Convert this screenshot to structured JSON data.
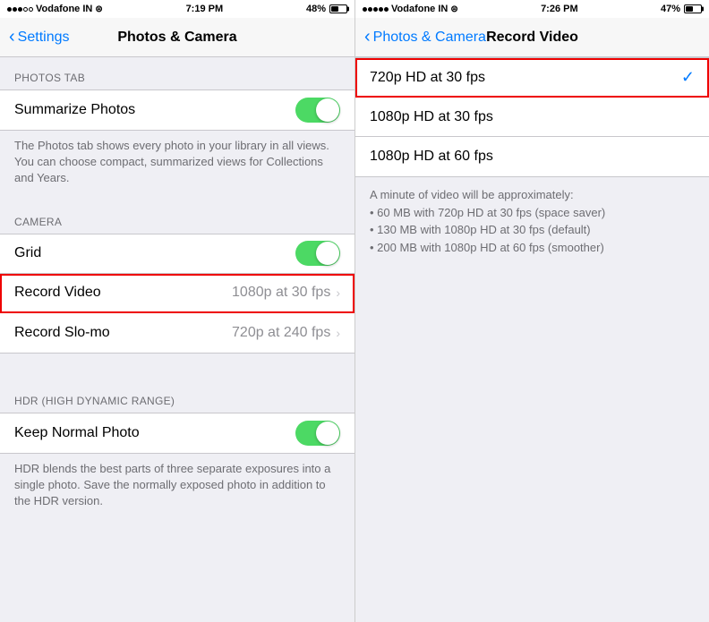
{
  "left_panel": {
    "status": {
      "carrier": "Vodafone IN",
      "time": "7:19 PM",
      "battery_pct": "48%"
    },
    "nav": {
      "back_label": "Settings",
      "title": "Photos & Camera"
    },
    "sections": [
      {
        "header": "PHOTOS TAB",
        "rows": [
          {
            "id": "summarize-photos",
            "label": "Summarize Photos",
            "type": "toggle",
            "toggle_on": true,
            "highlighted": false
          }
        ],
        "description": "The Photos tab shows every photo in your library in all views. You can choose compact, summarized views for Collections and Years."
      },
      {
        "header": "CAMERA",
        "rows": [
          {
            "id": "grid",
            "label": "Grid",
            "type": "toggle",
            "toggle_on": true,
            "highlighted": false
          },
          {
            "id": "record-video",
            "label": "Record Video",
            "type": "detail",
            "value": "1080p at 30 fps",
            "highlighted": true
          },
          {
            "id": "record-slomo",
            "label": "Record Slo-mo",
            "type": "detail",
            "value": "720p at 240 fps",
            "highlighted": false
          }
        ]
      },
      {
        "header": "HDR (HIGH DYNAMIC RANGE)",
        "rows": [
          {
            "id": "keep-normal-photo",
            "label": "Keep Normal Photo",
            "type": "toggle",
            "toggle_on": true,
            "highlighted": false
          }
        ],
        "description": "HDR blends the best parts of three separate exposures into a single photo. Save the normally exposed photo in addition to the HDR version."
      }
    ]
  },
  "right_panel": {
    "status": {
      "carrier": "Vodafone IN",
      "time": "7:26 PM",
      "battery_pct": "47%"
    },
    "nav": {
      "back_label": "Photos & Camera",
      "title": "Record Video"
    },
    "options": [
      {
        "id": "720p-30",
        "label": "720p HD at 30 fps",
        "selected": true
      },
      {
        "id": "1080p-30",
        "label": "1080p HD at 30 fps",
        "selected": false
      },
      {
        "id": "1080p-60",
        "label": "1080p HD at 60 fps",
        "selected": false
      }
    ],
    "info": "A minute of video will be approximately:\n• 60 MB with 720p HD at 30 fps (space saver)\n• 130 MB with 1080p HD at 30 fps (default)\n• 200 MB with 1080p HD at 60 fps (smoother)"
  }
}
